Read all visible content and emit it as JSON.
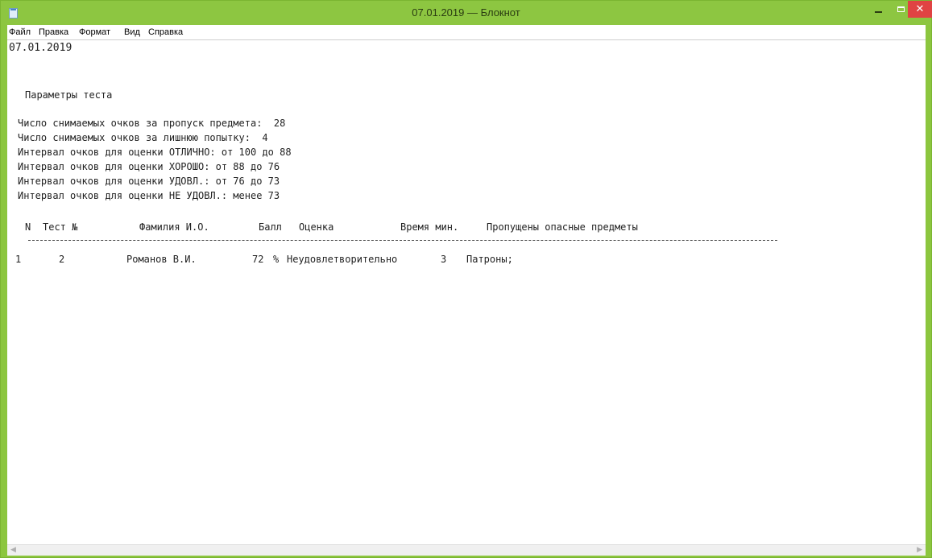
{
  "window": {
    "title": "07.01.2019 — Блокнот",
    "accent_color": "#8dc641",
    "close_color": "#e04343"
  },
  "menu": {
    "items": [
      "Файл",
      "Правка",
      "Формат",
      "Вид",
      "Справка"
    ]
  },
  "document": {
    "date": "07.01.2019",
    "section_title": "Параметры теста",
    "params": [
      "Число снимаемых очков за пропуск предмета:  28",
      "Число снимаемых очков за лишнюю попытку:  4",
      "Интервал очков для оценки ОТЛИЧНО: от 100 до 88",
      "Интервал очков для оценки ХОРОШО: от 88 до 76",
      "Интервал очков для оценки УДОВЛ.: от 76 до 73",
      "Интервал очков для оценки НЕ УДОВЛ.: менее 73"
    ],
    "table": {
      "headers": {
        "n": "N",
        "test": "Тест №",
        "name": "Фамилия И.О.",
        "score": "Балл",
        "grade": "Оценка",
        "time": "Время мин.",
        "missed": "Пропущены опасные предметы"
      },
      "rows": [
        {
          "n": "1",
          "test": "2",
          "name": "Романов В.И.",
          "score": "72",
          "pct": "%",
          "grade": "Неудовлетворительно",
          "time": "3",
          "missed": "Патроны;"
        }
      ]
    }
  },
  "icons": {
    "app": "notepad-icon",
    "minimize": "minimize-icon",
    "maximize": "maximize-icon",
    "close": "close-icon"
  }
}
